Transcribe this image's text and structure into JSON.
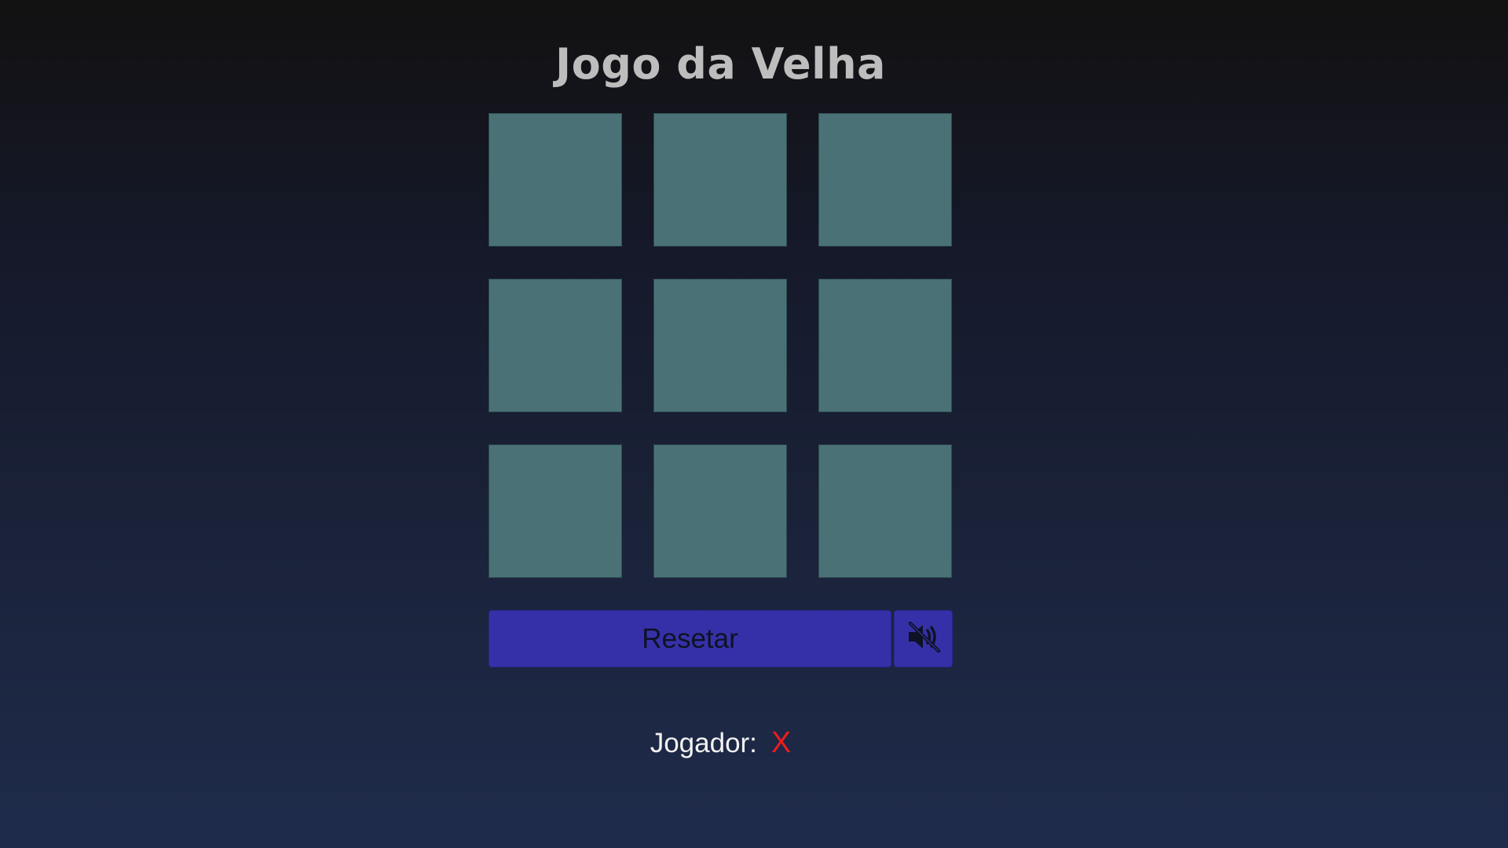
{
  "app": {
    "title": "Jogo da Velha"
  },
  "board": {
    "cells": [
      "",
      "",
      "",
      "",
      "",
      "",
      "",
      "",
      ""
    ]
  },
  "controls": {
    "reset_label": "Resetar",
    "sound_icon": "speaker-muted-icon"
  },
  "status": {
    "label": "Jogador:",
    "current_player": "X"
  },
  "colors": {
    "cell": "#4a7276",
    "button": "#3630a8",
    "player_x": "#ee1c1c",
    "title": "#bdbdbd"
  }
}
